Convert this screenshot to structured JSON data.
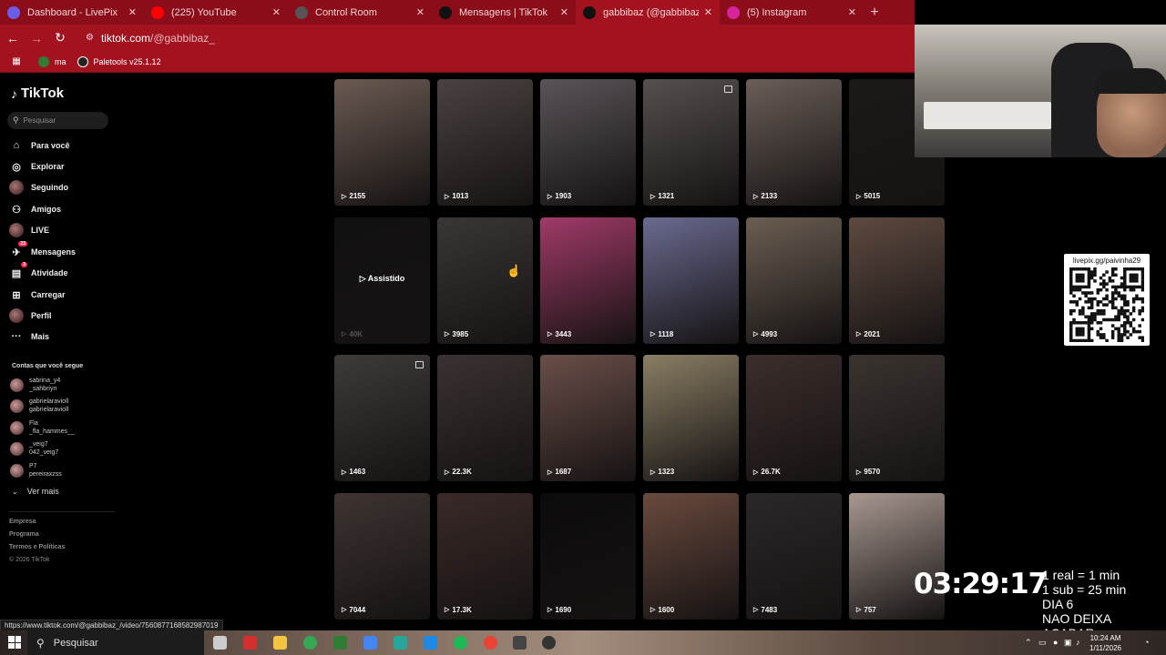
{
  "browser": {
    "tabs": [
      {
        "label": "Dashboard - LivePix",
        "icon": "globe-icon",
        "color": "#6c5ce7",
        "active": false
      },
      {
        "label": "(225) YouTube",
        "icon": "youtube-icon",
        "color": "#ff0000",
        "active": false
      },
      {
        "label": "Control Room",
        "icon": "globe-icon",
        "color": "#555555",
        "active": false
      },
      {
        "label": "Mensagens | TikTok",
        "icon": "tiktok-icon",
        "color": "#111111",
        "active": false
      },
      {
        "label": "gabbibaz (@gabbibaz_) | TikTok",
        "icon": "tiktok-icon",
        "color": "#111111",
        "active": true
      },
      {
        "label": "(5) Instagram",
        "icon": "instagram-icon",
        "color": "#d6249f",
        "active": false
      }
    ],
    "new_tab": "+",
    "url_host": "tiktok.com",
    "url_path": "/@gabbibaz_",
    "bookmarks": [
      {
        "label": "ma",
        "color": "#2e7d32"
      },
      {
        "label": "Paletools v25.1.12",
        "color": "#222222"
      }
    ],
    "status_url": "https://www.tiktok.com/@gabbibaz_/video/7560877168582987019"
  },
  "tiktok": {
    "logo": "TikTok",
    "search_placeholder": "Pesquisar",
    "nav": [
      {
        "label": "Para você",
        "icon": "home-icon",
        "glyph": "⌂"
      },
      {
        "label": "Explorar",
        "icon": "compass-icon",
        "glyph": "◎"
      },
      {
        "label": "Seguindo",
        "icon": "following-avatar-icon",
        "glyph": ""
      },
      {
        "label": "Amigos",
        "icon": "friends-icon",
        "glyph": "⚇"
      },
      {
        "label": "LIVE",
        "icon": "live-avatar-icon",
        "glyph": ""
      },
      {
        "label": "Mensagens",
        "icon": "messages-icon",
        "glyph": "✈",
        "badge": "23"
      },
      {
        "label": "Atividade",
        "icon": "activity-icon",
        "glyph": "▤",
        "badge": "3"
      },
      {
        "label": "Carregar",
        "icon": "upload-icon",
        "glyph": "⊞"
      },
      {
        "label": "Perfil",
        "icon": "profile-avatar-icon",
        "glyph": ""
      },
      {
        "label": "Mais",
        "icon": "more-icon",
        "glyph": "···"
      }
    ],
    "following_title": "Contas que você segue",
    "following": [
      {
        "name": "sabrina_y4",
        "handle": "_sahbriyn"
      },
      {
        "name": "gabrielaravioll",
        "handle": "gabrielaravioll"
      },
      {
        "name": "Fla",
        "handle": "_fla_hammes__"
      },
      {
        "name": "_veig7",
        "handle": "042_veig7"
      },
      {
        "name": "P7",
        "handle": "pereiraxzss"
      }
    ],
    "see_more": "Ver mais",
    "footer": [
      "Empresa",
      "Programa",
      "Termos e Políticas",
      "© 2026 TikTok"
    ],
    "videos": [
      {
        "views": "2155",
        "tone": "#6b5a52"
      },
      {
        "views": "1013",
        "tone": "#4a4240"
      },
      {
        "views": "1903",
        "tone": "#5a5458"
      },
      {
        "views": "1321",
        "tone": "#55504e",
        "pinned": true
      },
      {
        "views": "2133",
        "tone": "#6a5e58"
      },
      {
        "views": "5015",
        "tone": "#1c1918"
      },
      {
        "views": "40K",
        "tone": "#121111",
        "watched": "Assistido"
      },
      {
        "views": "3985",
        "tone": "#3a3634"
      },
      {
        "views": "3443",
        "tone": "#a03a68"
      },
      {
        "views": "1118",
        "tone": "#6a6a90"
      },
      {
        "views": "4993",
        "tone": "#6b5e52"
      },
      {
        "views": "2021",
        "tone": "#5e4a40"
      },
      {
        "views": "1463",
        "tone": "#3e3a3a",
        "pinned": true
      },
      {
        "views": "22.3K",
        "tone": "#3a3230"
      },
      {
        "views": "1687",
        "tone": "#6a4e48"
      },
      {
        "views": "1323",
        "tone": "#8a7e64"
      },
      {
        "views": "26.7K",
        "tone": "#3c2e2c"
      },
      {
        "views": "9570",
        "tone": "#3a3430"
      },
      {
        "views": "7044",
        "tone": "#3e3432"
      },
      {
        "views": "17.3K",
        "tone": "#3a2a28"
      },
      {
        "views": "1690",
        "tone": "#0c0b0b"
      },
      {
        "views": "1600",
        "tone": "#6a4a3e"
      },
      {
        "views": "7483",
        "tone": "#2a2828"
      },
      {
        "views": "757",
        "tone": "#a89890"
      }
    ]
  },
  "overlay": {
    "qr_label": "livepix.gg/paivinha29",
    "timer": "03:29:17",
    "rules": [
      "1 real = 1 min",
      "1 sub = 25 min",
      "DIA 6",
      "NAO DEIXA ACABAR"
    ]
  },
  "taskbar": {
    "search_placeholder": "Pesquisar",
    "time": "10:24 AM",
    "date": "1/11/2026",
    "apps": [
      {
        "icon": "task-view-icon",
        "color": "#cccccc"
      },
      {
        "icon": "app-red-icon",
        "color": "#d32f2f"
      },
      {
        "icon": "file-explorer-icon",
        "color": "#f4c542"
      },
      {
        "icon": "chrome-icon",
        "color": "#34a853"
      },
      {
        "icon": "app-green-icon",
        "color": "#2e7d32"
      },
      {
        "icon": "store-icon",
        "color": "#4285f4"
      },
      {
        "icon": "app-teal-icon",
        "color": "#26a69a"
      },
      {
        "icon": "edge-icon",
        "color": "#1e88e5"
      },
      {
        "icon": "spotify-icon",
        "color": "#1db954"
      },
      {
        "icon": "chrome-icon",
        "color": "#ea4335"
      },
      {
        "icon": "app-dark-icon",
        "color": "#444444"
      },
      {
        "icon": "obs-icon",
        "color": "#333333"
      }
    ]
  }
}
